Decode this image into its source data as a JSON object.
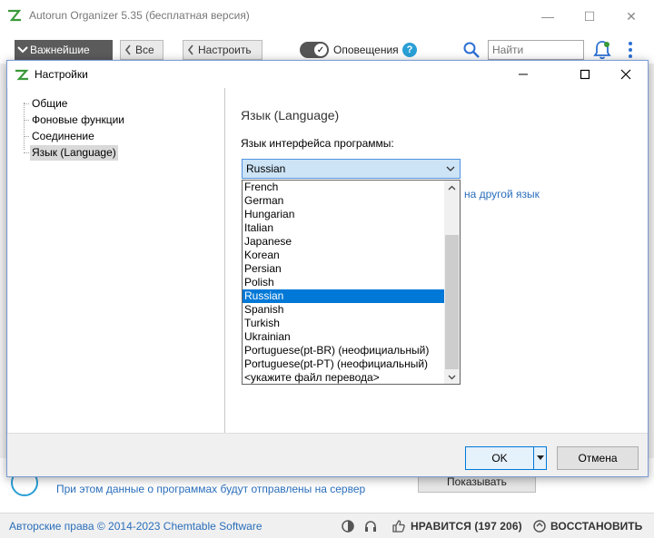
{
  "main_window": {
    "title": "Autorun Organizer 5.35 (бесплатная версия)",
    "controls": {
      "minimize": "—",
      "maximize": "☐",
      "close": "✕"
    }
  },
  "toolbar": {
    "important_label": "Важнейшие",
    "all_label": "Все",
    "configure_label": "Настроить",
    "notifications_label": "Оповещения",
    "notifications_enabled": true,
    "help_glyph": "?",
    "search_placeholder": "Найти"
  },
  "dialog": {
    "title": "Настройки",
    "tree": [
      {
        "label": "Общие",
        "selected": false
      },
      {
        "label": "Фоновые функции",
        "selected": false
      },
      {
        "label": "Соединение",
        "selected": false
      },
      {
        "label": "Язык (Language)",
        "selected": true
      }
    ],
    "section_title": "Язык (Language)",
    "field_label": "Язык интерфейса программы:",
    "combo_value": "Russian",
    "link_text": "на другой язык",
    "dropdown_items": [
      "French",
      "German",
      "Hungarian",
      "Italian",
      "Japanese",
      "Korean",
      "Persian",
      "Polish",
      "Russian",
      "Spanish",
      "Turkish",
      "Ukrainian",
      "Portuguese(pt-BR) (неофициальный)",
      "Portuguese(pt-PT) (неофициальный)",
      "<укажите файл перевода>"
    ],
    "selected_item": "Russian",
    "ok_label": "OK",
    "cancel_label": "Отмена"
  },
  "bottom": {
    "hint": "При этом данные о программах будут отправлены на сервер",
    "show_button": "Показывать"
  },
  "status_bar": {
    "copyright": "Авторские права © 2014-2023 Chemtable Software",
    "like_label": "НРАВИТСЯ (197 206)",
    "restore_label": "ВОССТАНОВИТЬ"
  },
  "colors": {
    "accent": "#0078d7",
    "link": "#2a6ebb",
    "help": "#2a9fd6",
    "primary_button": "#5b5b5b"
  }
}
